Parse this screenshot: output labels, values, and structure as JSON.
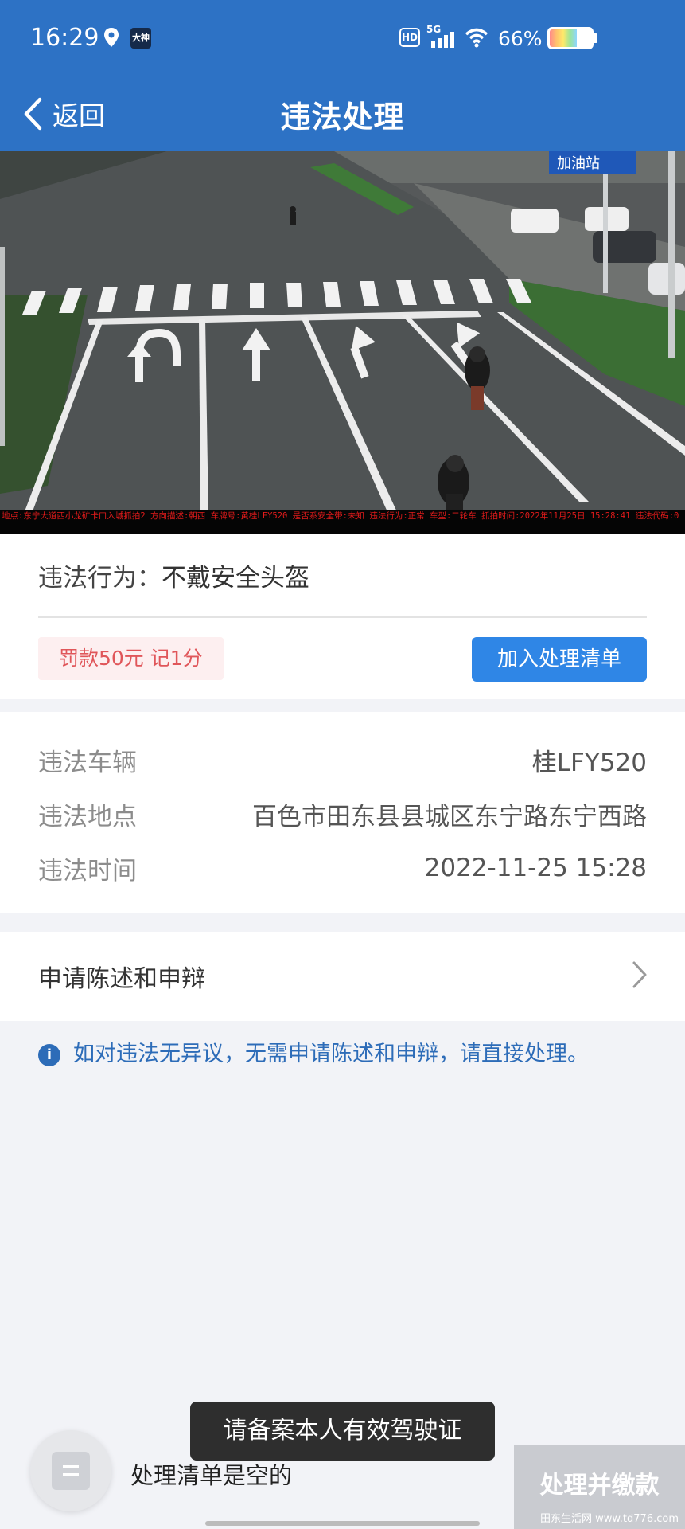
{
  "status_bar": {
    "time": "16:29",
    "app_icon_text": "大神",
    "hd": "HD",
    "network": "5G",
    "battery": "66%",
    "battery_level": 0.66
  },
  "nav": {
    "back_label": "返回",
    "title": "违法处理"
  },
  "photo": {
    "caption": "地点:东宁大道西小龙矿卡口入城抓拍2 方向描述:朝西 车牌号:黄桂LFY520 是否系安全带:未知 违法行为:正常 车型:二轮车 抓拍时间:2022年11月25日 15:28:41 违法代码:0",
    "sign_text": "加油站"
  },
  "violation": {
    "label": "违法行为：",
    "value": "不戴安全头盔",
    "fine": "罚款50元  记1分",
    "add_button": "加入处理清单"
  },
  "details": [
    {
      "label": "违法车辆",
      "value": "桂LFY520"
    },
    {
      "label": "违法地点",
      "value": "百色市田东县县城区东宁路东宁西路"
    },
    {
      "label": "违法时间",
      "value": "2022-11-25  15:28"
    }
  ],
  "appeal": {
    "label": "申请陈述和申辩"
  },
  "note": {
    "text": "如对违法无异议，无需申请陈述和申辩，请直接处理。"
  },
  "bottom": {
    "empty_text": "处理清单是空的",
    "pay_button": "处理并缴款",
    "toast": "请备案本人有效驾驶证",
    "watermark": "田东生活网 www.td776.com"
  }
}
